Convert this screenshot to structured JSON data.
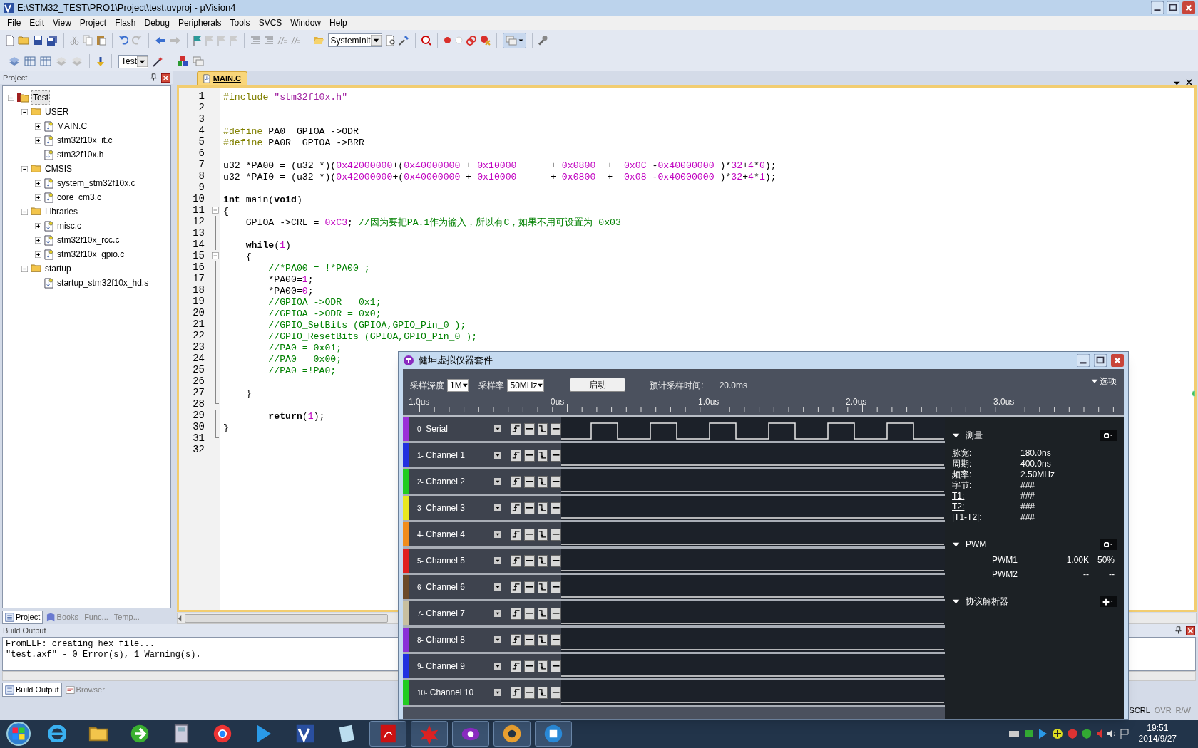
{
  "window": {
    "title": "E:\\STM32_TEST\\PRO1\\Project\\test.uvproj - µVision4"
  },
  "menu": [
    "File",
    "Edit",
    "View",
    "Project",
    "Flash",
    "Debug",
    "Peripherals",
    "Tools",
    "SVCS",
    "Window",
    "Help"
  ],
  "toolbar": {
    "function_combo": "SystemInit",
    "target_combo": "Test"
  },
  "project_panel": {
    "title": "Project",
    "tree": [
      {
        "label": "Test",
        "kind": "root",
        "expanded": true,
        "selected": true,
        "children": [
          {
            "label": "USER",
            "kind": "group",
            "expanded": true,
            "selected": false,
            "children": [
              {
                "label": "MAIN.C",
                "kind": "file",
                "expanded": false,
                "selected": false
              },
              {
                "label": "stm32f10x_it.c",
                "kind": "file",
                "expanded": false,
                "selected": false
              },
              {
                "label": "stm32f10x.h",
                "kind": "file",
                "selected": false
              }
            ]
          },
          {
            "label": "CMSIS",
            "kind": "group",
            "expanded": true,
            "selected": false,
            "children": [
              {
                "label": "system_stm32f10x.c",
                "kind": "file",
                "expanded": false,
                "selected": false
              },
              {
                "label": "core_cm3.c",
                "kind": "file",
                "expanded": false,
                "selected": false
              }
            ]
          },
          {
            "label": "Libraries",
            "kind": "group",
            "expanded": true,
            "selected": false,
            "children": [
              {
                "label": "misc.c",
                "kind": "file",
                "expanded": false,
                "selected": false
              },
              {
                "label": "stm32f10x_rcc.c",
                "kind": "file",
                "expanded": false,
                "selected": false
              },
              {
                "label": "stm32f10x_gpio.c",
                "kind": "file",
                "expanded": false,
                "selected": false
              }
            ]
          },
          {
            "label": "startup",
            "kind": "group",
            "expanded": true,
            "selected": false,
            "children": [
              {
                "label": "startup_stm32f10x_hd.s",
                "kind": "file",
                "selected": false
              }
            ]
          }
        ]
      }
    ],
    "tabs": [
      {
        "label": "Project",
        "selected": true
      },
      {
        "label": "Books",
        "selected": false
      },
      {
        "label": "Func...",
        "selected": false
      },
      {
        "label": "Temp...",
        "selected": false
      }
    ]
  },
  "editor": {
    "tabs": [
      {
        "label": "MAIN.C",
        "selected": true
      }
    ],
    "lines": [
      {
        "number": "1",
        "kind": "plain",
        "tokens": [
          {
            "kind": "pp",
            "text": "#include"
          },
          {
            "kind": "str",
            "text": " \"stm32f10x.h\""
          }
        ]
      },
      {
        "number": "2",
        "kind": "plain"
      },
      {
        "number": "3",
        "kind": "plain"
      },
      {
        "number": "4",
        "kind": "plain",
        "tokens": [
          {
            "kind": "pp",
            "text": "#define"
          },
          {
            "kind": "plain",
            "text": " PA0  GPIOA ->ODR"
          }
        ]
      },
      {
        "number": "5",
        "kind": "plain",
        "tokens": [
          {
            "kind": "pp",
            "text": "#define"
          },
          {
            "kind": "plain",
            "text": " PA0R  GPIOA ->BRR"
          }
        ]
      },
      {
        "number": "6",
        "kind": "plain"
      },
      {
        "number": "7",
        "kind": "plain",
        "tokens": [
          {
            "kind": "plain",
            "text": "u32 *PA00 = (u32 *)("
          },
          {
            "kind": "num",
            "text": "0x42000000"
          },
          {
            "kind": "plain",
            "text": "+("
          },
          {
            "kind": "num",
            "text": "0x40000000"
          },
          {
            "kind": "plain",
            "text": " + "
          },
          {
            "kind": "num",
            "text": "0x10000"
          },
          {
            "kind": "plain",
            "text": "      + "
          },
          {
            "kind": "num",
            "text": "0x0800"
          },
          {
            "kind": "plain",
            "text": "  +  "
          },
          {
            "kind": "num",
            "text": "0x0C"
          },
          {
            "kind": "plain",
            "text": " -"
          },
          {
            "kind": "num",
            "text": "0x40000000"
          },
          {
            "kind": "plain",
            "text": " )*"
          },
          {
            "kind": "num",
            "text": "32"
          },
          {
            "kind": "plain",
            "text": "+"
          },
          {
            "kind": "num",
            "text": "4"
          },
          {
            "kind": "plain",
            "text": "*"
          },
          {
            "kind": "num",
            "text": "0"
          },
          {
            "kind": "plain",
            "text": ");"
          }
        ]
      },
      {
        "number": "8",
        "kind": "plain",
        "tokens": [
          {
            "kind": "plain",
            "text": "u32 *PAI0 = (u32 *)("
          },
          {
            "kind": "num",
            "text": "0x42000000"
          },
          {
            "kind": "plain",
            "text": "+("
          },
          {
            "kind": "num",
            "text": "0x40000000"
          },
          {
            "kind": "plain",
            "text": " + "
          },
          {
            "kind": "num",
            "text": "0x10000"
          },
          {
            "kind": "plain",
            "text": "      + "
          },
          {
            "kind": "num",
            "text": "0x0800"
          },
          {
            "kind": "plain",
            "text": "  +  "
          },
          {
            "kind": "num",
            "text": "0x08"
          },
          {
            "kind": "plain",
            "text": " -"
          },
          {
            "kind": "num",
            "text": "0x40000000"
          },
          {
            "kind": "plain",
            "text": " )*"
          },
          {
            "kind": "num",
            "text": "32"
          },
          {
            "kind": "plain",
            "text": "+"
          },
          {
            "kind": "num",
            "text": "4"
          },
          {
            "kind": "plain",
            "text": "*"
          },
          {
            "kind": "num",
            "text": "1"
          },
          {
            "kind": "plain",
            "text": ");"
          }
        ]
      },
      {
        "number": "9",
        "kind": "plain"
      },
      {
        "number": "10",
        "kind": "plain",
        "tokens": [
          {
            "kind": "kw",
            "text": "int"
          },
          {
            "kind": "plain",
            "text": " main("
          },
          {
            "kind": "kw",
            "text": "void"
          },
          {
            "kind": "plain",
            "text": ")"
          }
        ]
      },
      {
        "number": "11",
        "kind": "open",
        "tokens": [
          {
            "kind": "plain",
            "text": "{"
          }
        ]
      },
      {
        "number": "12",
        "kind": "inside",
        "tokens": [
          {
            "kind": "plain",
            "text": "    GPIOA ->CRL = "
          },
          {
            "kind": "num",
            "text": "0xC3"
          },
          {
            "kind": "plain",
            "text": "; "
          },
          {
            "kind": "cm",
            "text": "//因为要把PA.1作为输入，所以有C，如果不用可设置为 0x03"
          }
        ]
      },
      {
        "number": "13",
        "kind": "inside"
      },
      {
        "number": "14",
        "kind": "inside",
        "tokens": [
          {
            "kind": "kw",
            "text": "    while"
          },
          {
            "kind": "plain",
            "text": "("
          },
          {
            "kind": "num",
            "text": "1"
          },
          {
            "kind": "plain",
            "text": ")"
          }
        ]
      },
      {
        "number": "15",
        "kind": "open",
        "tokens": [
          {
            "kind": "plain",
            "text": "    {"
          }
        ]
      },
      {
        "number": "16",
        "kind": "inside",
        "tokens": [
          {
            "kind": "cm",
            "text": "        //*PA00 = !*PA00 ;"
          }
        ]
      },
      {
        "number": "17",
        "kind": "inside",
        "tokens": [
          {
            "kind": "plain",
            "text": "        *PA00="
          },
          {
            "kind": "num",
            "text": "1"
          },
          {
            "kind": "plain",
            "text": ";"
          }
        ]
      },
      {
        "number": "18",
        "kind": "inside",
        "tokens": [
          {
            "kind": "plain",
            "text": "        *PA00="
          },
          {
            "kind": "num",
            "text": "0"
          },
          {
            "kind": "plain",
            "text": ";"
          }
        ]
      },
      {
        "number": "19",
        "kind": "inside",
        "tokens": [
          {
            "kind": "cm",
            "text": "        //GPIOA ->ODR = 0x1;"
          }
        ]
      },
      {
        "number": "20",
        "kind": "inside",
        "tokens": [
          {
            "kind": "cm",
            "text": "        //GPIOA ->ODR = 0x0;"
          }
        ]
      },
      {
        "number": "21",
        "kind": "inside",
        "tokens": [
          {
            "kind": "cm",
            "text": "        //GPIO_SetBits (GPIOA,GPIO_Pin_0 );"
          }
        ]
      },
      {
        "number": "22",
        "kind": "inside",
        "tokens": [
          {
            "kind": "cm",
            "text": "        //GPIO_ResetBits (GPIOA,GPIO_Pin_0 );"
          }
        ]
      },
      {
        "number": "23",
        "kind": "inside",
        "tokens": [
          {
            "kind": "cm",
            "text": "        //PA0 = 0x01;"
          }
        ]
      },
      {
        "number": "24",
        "kind": "inside",
        "tokens": [
          {
            "kind": "cm",
            "text": "        //PA0 = 0x00;"
          }
        ]
      },
      {
        "number": "25",
        "kind": "inside",
        "tokens": [
          {
            "kind": "cm",
            "text": "        //PA0 =!PA0;"
          }
        ]
      },
      {
        "number": "26",
        "kind": "inside"
      },
      {
        "number": "27",
        "kind": "inside",
        "tokens": [
          {
            "kind": "plain",
            "text": "    }"
          }
        ]
      },
      {
        "number": "28",
        "kind": "close"
      },
      {
        "number": "29",
        "kind": "inside",
        "tokens": [
          {
            "kind": "kw",
            "text": "        return"
          },
          {
            "kind": "plain",
            "text": "("
          },
          {
            "kind": "num",
            "text": "1"
          },
          {
            "kind": "plain",
            "text": ");"
          }
        ]
      },
      {
        "number": "30",
        "kind": "inside",
        "tokens": [
          {
            "kind": "plain",
            "text": "}"
          }
        ]
      },
      {
        "number": "31",
        "kind": "close"
      },
      {
        "number": "32",
        "kind": "plain"
      }
    ]
  },
  "build_output": {
    "title": "Build Output",
    "lines": [
      "FromELF: creating hex file...",
      "\"test.axf\" - 0 Error(s), 1 Warning(s)."
    ],
    "tabs": [
      {
        "label": "Build Output",
        "selected": true
      },
      {
        "label": "Browser",
        "selected": false
      }
    ]
  },
  "status_bar": [
    "SCRL",
    "OVR",
    "R/W"
  ],
  "analyzer": {
    "title": "健坤虚拟仪器套件",
    "depth_label": "采样深度",
    "depth": "1M",
    "rate_label": "采样率",
    "rate": "50MHz",
    "start_button": "启动",
    "estimate_label": "预计采样时间:",
    "estimate": "20.0ms",
    "options": "选项",
    "ruler": [
      "1.0us",
      "0us",
      "1.0us",
      "2.0us",
      "3.0us"
    ],
    "channels": [
      {
        "number": "0-",
        "name": "Serial",
        "color": "#9b30d8",
        "kind": "pulses"
      },
      {
        "number": "1-",
        "name": "Channel 1",
        "color": "#2030e0",
        "kind": "low"
      },
      {
        "number": "2-",
        "name": "Channel 2",
        "color": "#22cc22",
        "kind": "low"
      },
      {
        "number": "3-",
        "name": "Channel 3",
        "color": "#e8e820",
        "kind": "low"
      },
      {
        "number": "4-",
        "name": "Channel 4",
        "color": "#f08c1c",
        "kind": "low"
      },
      {
        "number": "5-",
        "name": "Channel 5",
        "color": "#e02020",
        "kind": "low"
      },
      {
        "number": "6-",
        "name": "Channel 6",
        "color": "#6b4a2a",
        "kind": "low"
      },
      {
        "number": "7-",
        "name": "Channel 7",
        "color": "#c8c0a0",
        "kind": "low"
      },
      {
        "number": "8-",
        "name": "Channel 8",
        "color": "#8a30d8",
        "kind": "low"
      },
      {
        "number": "9-",
        "name": "Channel 9",
        "color": "#2030e0",
        "kind": "low"
      },
      {
        "number": "10-",
        "name": "Channel 10",
        "color": "#22cc22",
        "kind": "low"
      }
    ],
    "measure": {
      "title": "测量",
      "rows": [
        {
          "label": "脉宽:",
          "value": "180.0ns",
          "underlined": false
        },
        {
          "label": "周期:",
          "value": "400.0ns",
          "underlined": false
        },
        {
          "label": "频率:",
          "value": "2.50MHz",
          "underlined": false
        },
        {
          "label": "字节:",
          "value": "###",
          "underlined": false
        },
        {
          "label": "T1:",
          "value": "###",
          "underlined": true
        },
        {
          "label": "T2:",
          "value": "###",
          "underlined": true
        },
        {
          "label": "|T1-T2|:",
          "value": "###",
          "underlined": false
        }
      ]
    },
    "pwm": {
      "title": "PWM",
      "rows": [
        {
          "name": "PWM1",
          "frequency": "1.00K",
          "duty": "50%"
        },
        {
          "name": "PWM2",
          "frequency": "--",
          "duty": "--"
        }
      ]
    },
    "protocol": {
      "title": "协议解析器"
    }
  },
  "taskbar": {
    "time": "19:51",
    "date": "2014/9/27"
  }
}
